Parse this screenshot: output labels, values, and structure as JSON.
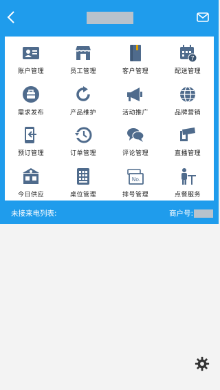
{
  "header": {
    "back_icon": "chevron-left-icon",
    "mail_icon": "envelope-icon"
  },
  "menu": {
    "items": [
      {
        "label": "账户管理",
        "icon": "id-card-icon"
      },
      {
        "label": "员工管理",
        "icon": "store-icon"
      },
      {
        "label": "客户管理",
        "icon": "book-icon"
      },
      {
        "label": "配送管理",
        "icon": "calendar-icon"
      },
      {
        "label": "需求发布",
        "icon": "briefcase-icon"
      },
      {
        "label": "产品维护",
        "icon": "refresh-icon"
      },
      {
        "label": "活动推广",
        "icon": "megaphone-icon"
      },
      {
        "label": "品牌营销",
        "icon": "globe-icon"
      },
      {
        "label": "预订管理",
        "icon": "phone-arrow-icon"
      },
      {
        "label": "订单管理",
        "icon": "history-icon"
      },
      {
        "label": "评论管理",
        "icon": "chat-bubbles-icon"
      },
      {
        "label": "直播管理",
        "icon": "camera-icon"
      },
      {
        "label": "今日供应",
        "icon": "warehouse-icon"
      },
      {
        "label": "桌位管理",
        "icon": "keypad-icon"
      },
      {
        "label": "排号管理",
        "icon": "ticket-icon"
      },
      {
        "label": "点餐服务",
        "icon": "waiter-icon"
      }
    ]
  },
  "calls": {
    "label": "未接来电列表:",
    "merchant_label": "商户号:"
  },
  "settings_icon": "gear-icon",
  "colors": {
    "primary_blue": "#1f9cec",
    "icon_slate": "#4f6b8c",
    "background": "#f3f3f3"
  }
}
